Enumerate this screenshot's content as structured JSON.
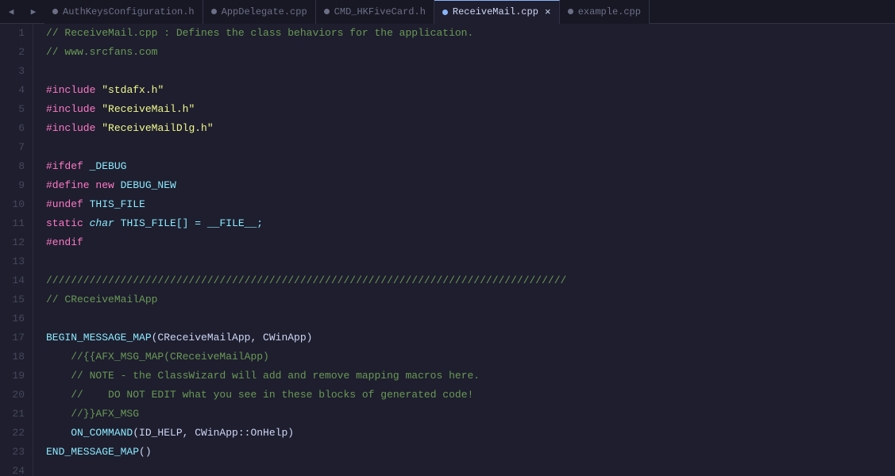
{
  "tabs": [
    {
      "label": "AuthKeysConfiguration.h",
      "active": false,
      "closable": false,
      "dot": true
    },
    {
      "label": "AppDelegate.cpp",
      "active": false,
      "closable": false,
      "dot": true
    },
    {
      "label": "CMD_HKFiveCard.h",
      "active": false,
      "closable": false,
      "dot": true
    },
    {
      "label": "ReceiveMail.cpp",
      "active": true,
      "closable": true,
      "dot": true
    },
    {
      "label": "example.cpp",
      "active": false,
      "closable": false,
      "dot": false
    }
  ],
  "lines": [
    {
      "num": 1,
      "tokens": [
        {
          "t": "// ReceiveMail.cpp : Defines the class behaviors for the application.",
          "c": "c-comment"
        }
      ]
    },
    {
      "num": 2,
      "tokens": [
        {
          "t": "// www.srcfans.com",
          "c": "c-comment"
        }
      ]
    },
    {
      "num": 3,
      "tokens": [
        {
          "t": "",
          "c": "c-normal"
        }
      ]
    },
    {
      "num": 4,
      "tokens": [
        {
          "t": "#include",
          "c": "c-preprocessor"
        },
        {
          "t": " ",
          "c": "c-normal"
        },
        {
          "t": "\"stdafx.h\"",
          "c": "c-include-file"
        }
      ]
    },
    {
      "num": 5,
      "tokens": [
        {
          "t": "#include",
          "c": "c-preprocessor"
        },
        {
          "t": " ",
          "c": "c-normal"
        },
        {
          "t": "\"ReceiveMail.h\"",
          "c": "c-include-file"
        }
      ]
    },
    {
      "num": 6,
      "tokens": [
        {
          "t": "#include",
          "c": "c-preprocessor"
        },
        {
          "t": " ",
          "c": "c-normal"
        },
        {
          "t": "\"ReceiveMailDlg.h\"",
          "c": "c-include-file"
        }
      ]
    },
    {
      "num": 7,
      "tokens": [
        {
          "t": "",
          "c": "c-normal"
        }
      ]
    },
    {
      "num": 8,
      "tokens": [
        {
          "t": "#ifdef",
          "c": "c-preprocessor"
        },
        {
          "t": " _DEBUG",
          "c": "c-cyan"
        }
      ]
    },
    {
      "num": 9,
      "tokens": [
        {
          "t": "#define",
          "c": "c-preprocessor"
        },
        {
          "t": " new",
          "c": "c-keyword"
        },
        {
          "t": " DEBUG_NEW",
          "c": "c-cyan"
        }
      ]
    },
    {
      "num": 10,
      "tokens": [
        {
          "t": "#undef",
          "c": "c-preprocessor"
        },
        {
          "t": " THIS_FILE",
          "c": "c-cyan"
        }
      ]
    },
    {
      "num": 11,
      "tokens": [
        {
          "t": "static",
          "c": "c-keyword"
        },
        {
          "t": " ",
          "c": "c-normal"
        },
        {
          "t": "char",
          "c": "c-type"
        },
        {
          "t": " THIS_FILE[] = __FILE__;",
          "c": "c-cyan"
        }
      ]
    },
    {
      "num": 12,
      "tokens": [
        {
          "t": "#endif",
          "c": "c-preprocessor"
        }
      ]
    },
    {
      "num": 13,
      "tokens": [
        {
          "t": "",
          "c": "c-normal"
        }
      ]
    },
    {
      "num": 14,
      "tokens": [
        {
          "t": "////////////////////////////////////////////////////////////////////////////////////",
          "c": "c-comment"
        }
      ]
    },
    {
      "num": 15,
      "tokens": [
        {
          "t": "// CReceiveMailApp",
          "c": "c-comment"
        }
      ]
    },
    {
      "num": 16,
      "tokens": [
        {
          "t": "",
          "c": "c-normal"
        }
      ]
    },
    {
      "num": 17,
      "tokens": [
        {
          "t": "BEGIN_MESSAGE_MAP",
          "c": "c-func"
        },
        {
          "t": "(CReceiveMailApp, CWinApp)",
          "c": "c-normal"
        }
      ]
    },
    {
      "num": 18,
      "tokens": [
        {
          "t": "    //{{AFX_MSG_MAP(CReceiveMailApp)",
          "c": "c-comment"
        }
      ]
    },
    {
      "num": 19,
      "tokens": [
        {
          "t": "    // NOTE - ",
          "c": "c-comment"
        },
        {
          "t": "the",
          "c": "c-comment"
        },
        {
          "t": " ClassWizard will add and remove mapping macros here.",
          "c": "c-comment"
        }
      ]
    },
    {
      "num": 20,
      "tokens": [
        {
          "t": "    //    DO NOT EDIT what you see in ",
          "c": "c-comment"
        },
        {
          "t": "these",
          "c": "c-comment"
        },
        {
          "t": " blocks of generated code!",
          "c": "c-comment"
        }
      ]
    },
    {
      "num": 21,
      "tokens": [
        {
          "t": "    //}}AFX_MSG",
          "c": "c-comment"
        }
      ]
    },
    {
      "num": 22,
      "tokens": [
        {
          "t": "    ON_COMMAND",
          "c": "c-func"
        },
        {
          "t": "(ID_HELP, CWinApp::OnHelp)",
          "c": "c-normal"
        }
      ]
    },
    {
      "num": 23,
      "tokens": [
        {
          "t": "END_MESSAGE_MAP",
          "c": "c-func"
        },
        {
          "t": "()",
          "c": "c-normal"
        }
      ]
    },
    {
      "num": 24,
      "tokens": [
        {
          "t": "",
          "c": "c-normal"
        }
      ]
    }
  ]
}
